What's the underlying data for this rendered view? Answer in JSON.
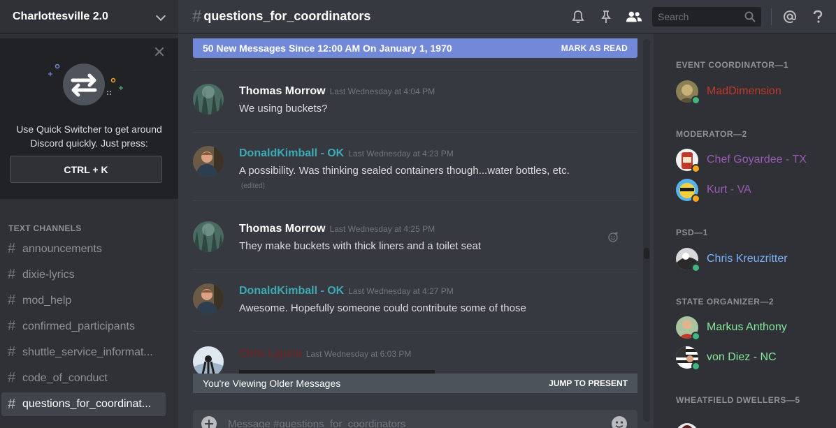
{
  "server": {
    "name": "Charlottesville 2.0"
  },
  "quick_switcher": {
    "text": "Use Quick Switcher to get around Discord quickly. Just press:",
    "shortcut": "CTRL + K"
  },
  "channels": {
    "category": "TEXT CHANNELS",
    "items": [
      {
        "name": "announcements"
      },
      {
        "name": "dixie-lyrics"
      },
      {
        "name": "mod_help"
      },
      {
        "name": "confirmed_participants"
      },
      {
        "name": "shuttle_service_informat..."
      },
      {
        "name": "code_of_conduct"
      },
      {
        "name": "questions_for_coordinat..."
      }
    ]
  },
  "header": {
    "channel_name": "questions_for_coordinators",
    "search_placeholder": "Search"
  },
  "new_messages": {
    "text": "50 New Messages Since 12:00 AM On January 1, 1970",
    "action": "MARK AS READ"
  },
  "messages": [
    {
      "author": "Thomas Morrow",
      "author_color": "#ffffff",
      "timestamp": "Last Wednesday at 4:04 PM",
      "text": "We using buckets?"
    },
    {
      "author": "DonaldKimball - OK",
      "author_color": "#3eaab5",
      "timestamp": "Last Wednesday at 4:23 PM",
      "text": "A possibility. Was thinking sealed containers though...water bottles, etc.",
      "edited": "(edited)"
    },
    {
      "author": "Thomas Morrow",
      "author_color": "#ffffff",
      "timestamp": "Last Wednesday at 4:25 PM",
      "text": "They make buckets with thick liners and a toilet seat"
    },
    {
      "author": "DonaldKimball - OK",
      "author_color": "#3eaab5",
      "timestamp": "Last Wednesday at 4:27 PM",
      "text": "Awesome. Hopefully someone could contribute some of those"
    },
    {
      "author": "Chris Liguria",
      "author_color": "#7a1f1f",
      "timestamp": "Last Wednesday at 6:03 PM",
      "text": ""
    }
  ],
  "older_messages": {
    "text": "You're Viewing Older Messages",
    "action": "JUMP TO PRESENT"
  },
  "input": {
    "placeholder": "Message #questions_for_coordinators"
  },
  "members": {
    "roles": [
      {
        "label": "EVENT COORDINATOR—1",
        "members": [
          {
            "name": "MadDimension",
            "color": "#c0392b",
            "status": "online"
          }
        ]
      },
      {
        "label": "MODERATOR—2",
        "members": [
          {
            "name": "Chef Goyardee - TX",
            "color": "#9b59b6",
            "status": "idle"
          },
          {
            "name": "Kurt - VA",
            "color": "#9b59b6",
            "status": "idle"
          }
        ]
      },
      {
        "label": "PSD—1",
        "members": [
          {
            "name": "Chris Kreuzritter",
            "color": "#7ab3ff",
            "status": "online"
          }
        ]
      },
      {
        "label": "STATE ORGANIZER—2",
        "members": [
          {
            "name": "Markus Anthony",
            "color": "#87e89c",
            "status": "online"
          },
          {
            "name": "von Diez - NC",
            "color": "#87e89c",
            "status": "online"
          }
        ]
      },
      {
        "label": "WHEATFIELD DWELLERS—5",
        "members": []
      }
    ]
  },
  "colors": {
    "online": "#43b581",
    "idle": "#faa61a",
    "accent": "#7289da"
  }
}
